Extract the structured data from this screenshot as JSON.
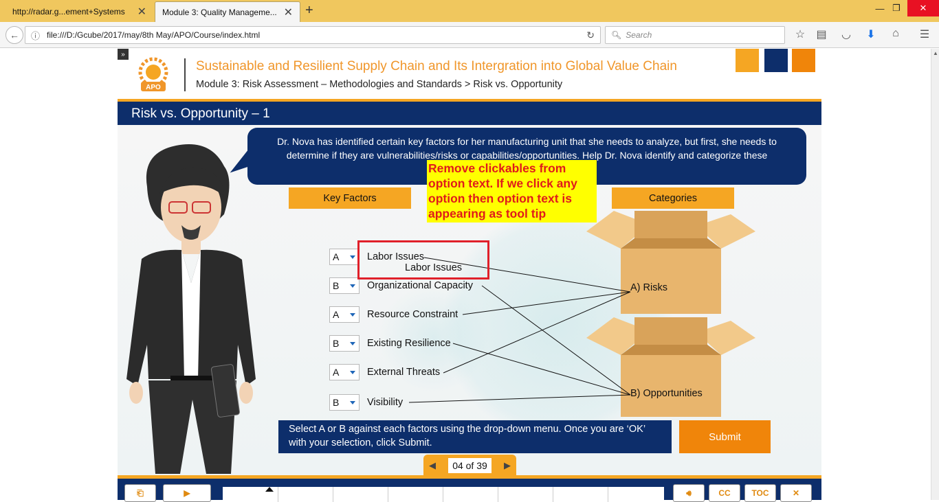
{
  "browser": {
    "tabs": [
      {
        "label": "http://radar.g...ement+Systems",
        "active": false
      },
      {
        "label": "Module 3: Quality Manageme...",
        "active": true
      }
    ],
    "url": "file:///D:/Gcube/2017/may/8th May/APO/Course/index.html",
    "search_placeholder": "Search"
  },
  "course": {
    "logo_text": "APO",
    "title": "Sustainable and Resilient Supply Chain and Its Intergration into Global Value Chain",
    "breadcrumb": "Module 3: Risk Assessment – Methodologies and Standards > Risk vs. Opportunity",
    "brand_colors": [
      "#f5a623",
      "#0d2e6b",
      "#f0850a"
    ]
  },
  "slide": {
    "title": "Risk vs. Opportunity – 1",
    "speech": "Dr. Nova has identified certain key factors for her manufacturing unit that she needs to analyze, but first, she needs to determine if they are vulnerabilities/risks or capabilities/opportunities. Help Dr. Nova identify and categorize these",
    "key_factors_header": "Key Factors",
    "categories_header": "Categories",
    "review_note": "Remove clickables from option text. If we click any option then option text is appearing as tool tip",
    "factors": [
      {
        "choice": "A",
        "label": "Labor Issues"
      },
      {
        "choice": "B",
        "label": "Organizational Capacity"
      },
      {
        "choice": "A",
        "label": "Resource Constraint"
      },
      {
        "choice": "B",
        "label": "Existing Resilience"
      },
      {
        "choice": "A",
        "label": "External Threats"
      },
      {
        "choice": "B",
        "label": "Visibility"
      }
    ],
    "tooltip_text": "Labor Issues",
    "categories": [
      {
        "label": "A)  Risks"
      },
      {
        "label": "B)  Opportunities"
      }
    ],
    "instruction": "Select A or B against each factors using the drop-down menu. Once you are ‘OK’ with your selection, click Submit.",
    "submit_label": "Submit",
    "pager": "04 of 39"
  },
  "footer": {
    "buttons": [
      "CC",
      "TOC"
    ]
  }
}
